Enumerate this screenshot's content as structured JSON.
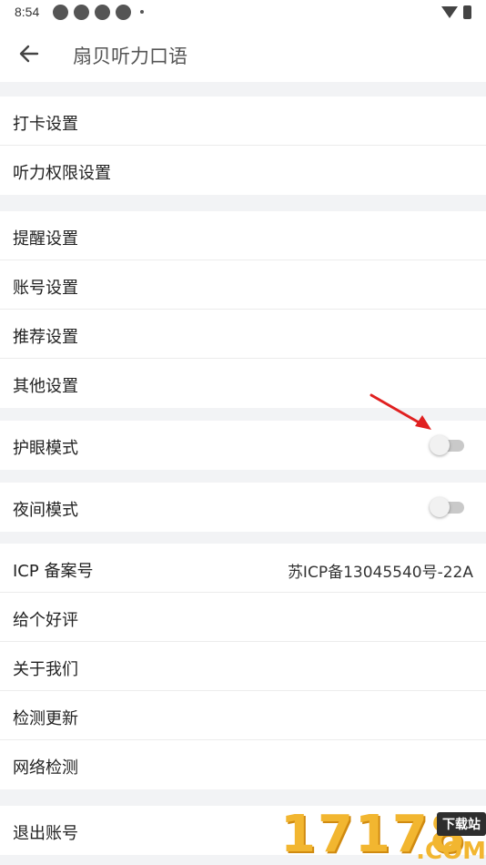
{
  "status_bar": {
    "time": "8:54",
    "icons": [
      "sync-icon",
      "notification-icon",
      "notification-icon",
      "sync-icon"
    ]
  },
  "app_bar": {
    "title": "扇贝听力口语",
    "back_icon": "arrow-left-icon"
  },
  "groups": {
    "g1": [
      "打卡设置",
      "听力权限设置"
    ],
    "g2": [
      "提醒设置",
      "账号设置",
      "推荐设置",
      "其他设置"
    ],
    "eye_mode": {
      "label": "护眼模式",
      "on": false
    },
    "night_mode": {
      "label": "夜间模式",
      "on": false
    },
    "g5": {
      "icp_label": "ICP 备案号",
      "icp_value": "苏ICP备13045540号-22A",
      "items": [
        "给个好评",
        "关于我们",
        "检测更新",
        "网络检测"
      ]
    },
    "logout": "退出账号"
  },
  "annotation": {
    "color": "#e02020"
  },
  "watermark": {
    "main": "17178",
    "badge": "下载站",
    "suffix": ".COM",
    "color": "#f2b630"
  }
}
